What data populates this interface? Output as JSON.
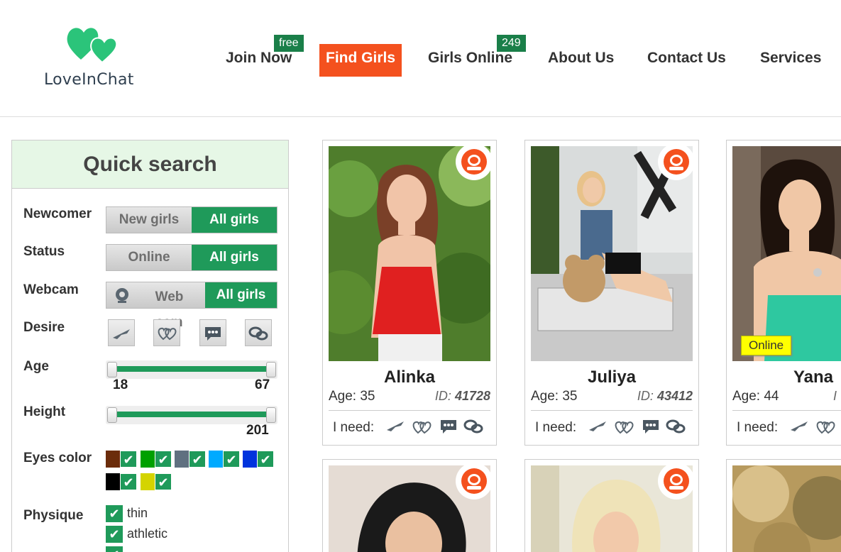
{
  "brand": {
    "name": "LoveInChat",
    "colors": {
      "green": "#1f9a5a",
      "orange": "#f4511e",
      "heart": "#2bc47a"
    }
  },
  "nav": {
    "items": [
      {
        "label": "Join Now",
        "badge": "free"
      },
      {
        "label": "Find Girls",
        "active": true
      },
      {
        "label": "Girls Online",
        "badge": "249"
      },
      {
        "label": "About Us"
      },
      {
        "label": "Contact Us"
      },
      {
        "label": "Services"
      }
    ]
  },
  "quick_search": {
    "title": "Quick search",
    "newcomer": {
      "label": "Newcomer",
      "off": "New girls",
      "on": "All girls"
    },
    "status": {
      "label": "Status",
      "off": "Online",
      "on": "All girls"
    },
    "webcam": {
      "label": "Webcam",
      "off_line1": "Web",
      "off_line2": "cam",
      "on": "All girls"
    },
    "desire": {
      "label": "Desire",
      "icons": [
        "plane-icon",
        "hearts-icon",
        "chat-icon",
        "chat-bubbles-icon"
      ]
    },
    "age": {
      "label": "Age",
      "min": "18",
      "max": "67"
    },
    "height": {
      "label": "Height",
      "max": "201"
    },
    "eyes": {
      "label": "Eyes color",
      "colors": [
        "#6b2c0b",
        "#00a000",
        "#607080",
        "#00aaff",
        "#0033dd",
        "#000000",
        "#d4d400"
      ]
    },
    "physique": {
      "label": "Physique",
      "options": [
        "thin",
        "athletic"
      ]
    }
  },
  "cards": [
    {
      "name": "Alinka",
      "age_label": "Age: 35",
      "id_prefix": "ID:",
      "id": "41728",
      "need_label": "I need:",
      "online": false,
      "webcam": true
    },
    {
      "name": "Juliya",
      "age_label": "Age: 35",
      "id_prefix": "ID:",
      "id": "43412",
      "need_label": "I need:",
      "online": false,
      "webcam": true
    },
    {
      "name": "Yana",
      "age_label": "Age: 44",
      "id_prefix": "I",
      "id": "",
      "need_label": "I need:",
      "online": true,
      "online_label": "Online",
      "webcam": false
    },
    {
      "webcam": true
    },
    {
      "webcam": true
    },
    {
      "webcam": false
    }
  ]
}
